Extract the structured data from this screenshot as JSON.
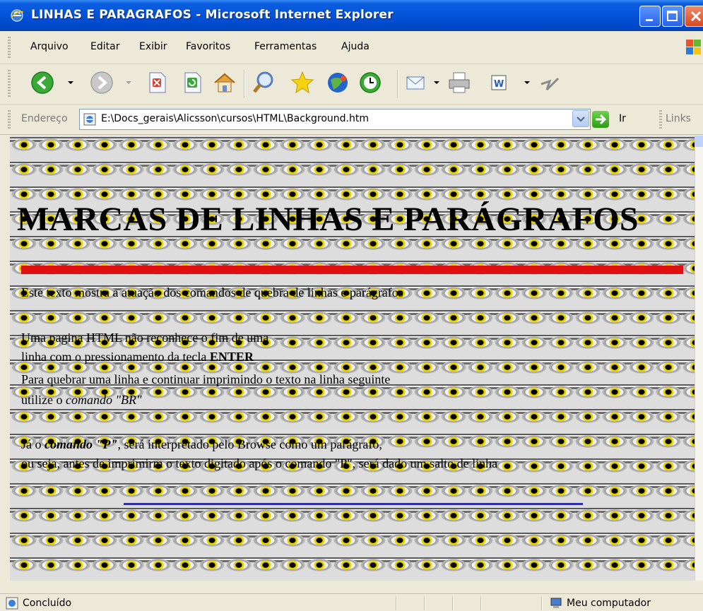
{
  "window": {
    "title": "LINHAS E PARAGRAFOS - Microsoft Internet Explorer"
  },
  "menu": [
    "Arquivo",
    "Editar",
    "Exibir",
    "Favoritos",
    "Ferramentas",
    "Ajuda"
  ],
  "toolbar": {
    "icons": [
      "back-icon",
      "forward-icon",
      "stop-icon",
      "refresh-icon",
      "home-icon",
      "search-icon",
      "favorites-icon",
      "media-icon",
      "history-icon",
      "mail-icon",
      "print-icon",
      "edit-icon",
      "messenger-icon"
    ]
  },
  "address": {
    "label": "Endereço",
    "url": "E:\\Docs_gerais\\Alicsson\\cursos\\HTML\\Background.htm",
    "go_label": "Ir",
    "links_label": "Links"
  },
  "page": {
    "heading": "MARCAS DE LINHAS E PARÁGRAFOS",
    "intro": "Este texto mostra a atuação dos comandos de quebra de linhas e parágrafos",
    "p2_line1": "Uma pagina HTML não reconhece o fim de uma",
    "p2_line2_a": "linha com o pressionamento da tecla ",
    "p2_line2_b": "ENTER",
    "p2_line3": "Para quebrar uma linha e continuar imprimindo o texto na linha seguinte",
    "p2_line4_a": "utilize o ",
    "p2_line4_b": "comando  \"BR\"",
    "p3_line1_a": "Já o ",
    "p3_line1_b": "comando  \"P\"",
    "p3_line1_c": ", será interpretado pelo Browse como um parágrafo,",
    "p3_line2": "ou seja, antes de imprimirm o texto digitado após o comando \"P\", será dado um salto de linha"
  },
  "status": {
    "text": "Concluído",
    "zone": "Meu computador"
  },
  "colors": {
    "title_bar": "#0553d8",
    "red_rule": "#e01010",
    "blue_rule": "#2f2fa5"
  }
}
